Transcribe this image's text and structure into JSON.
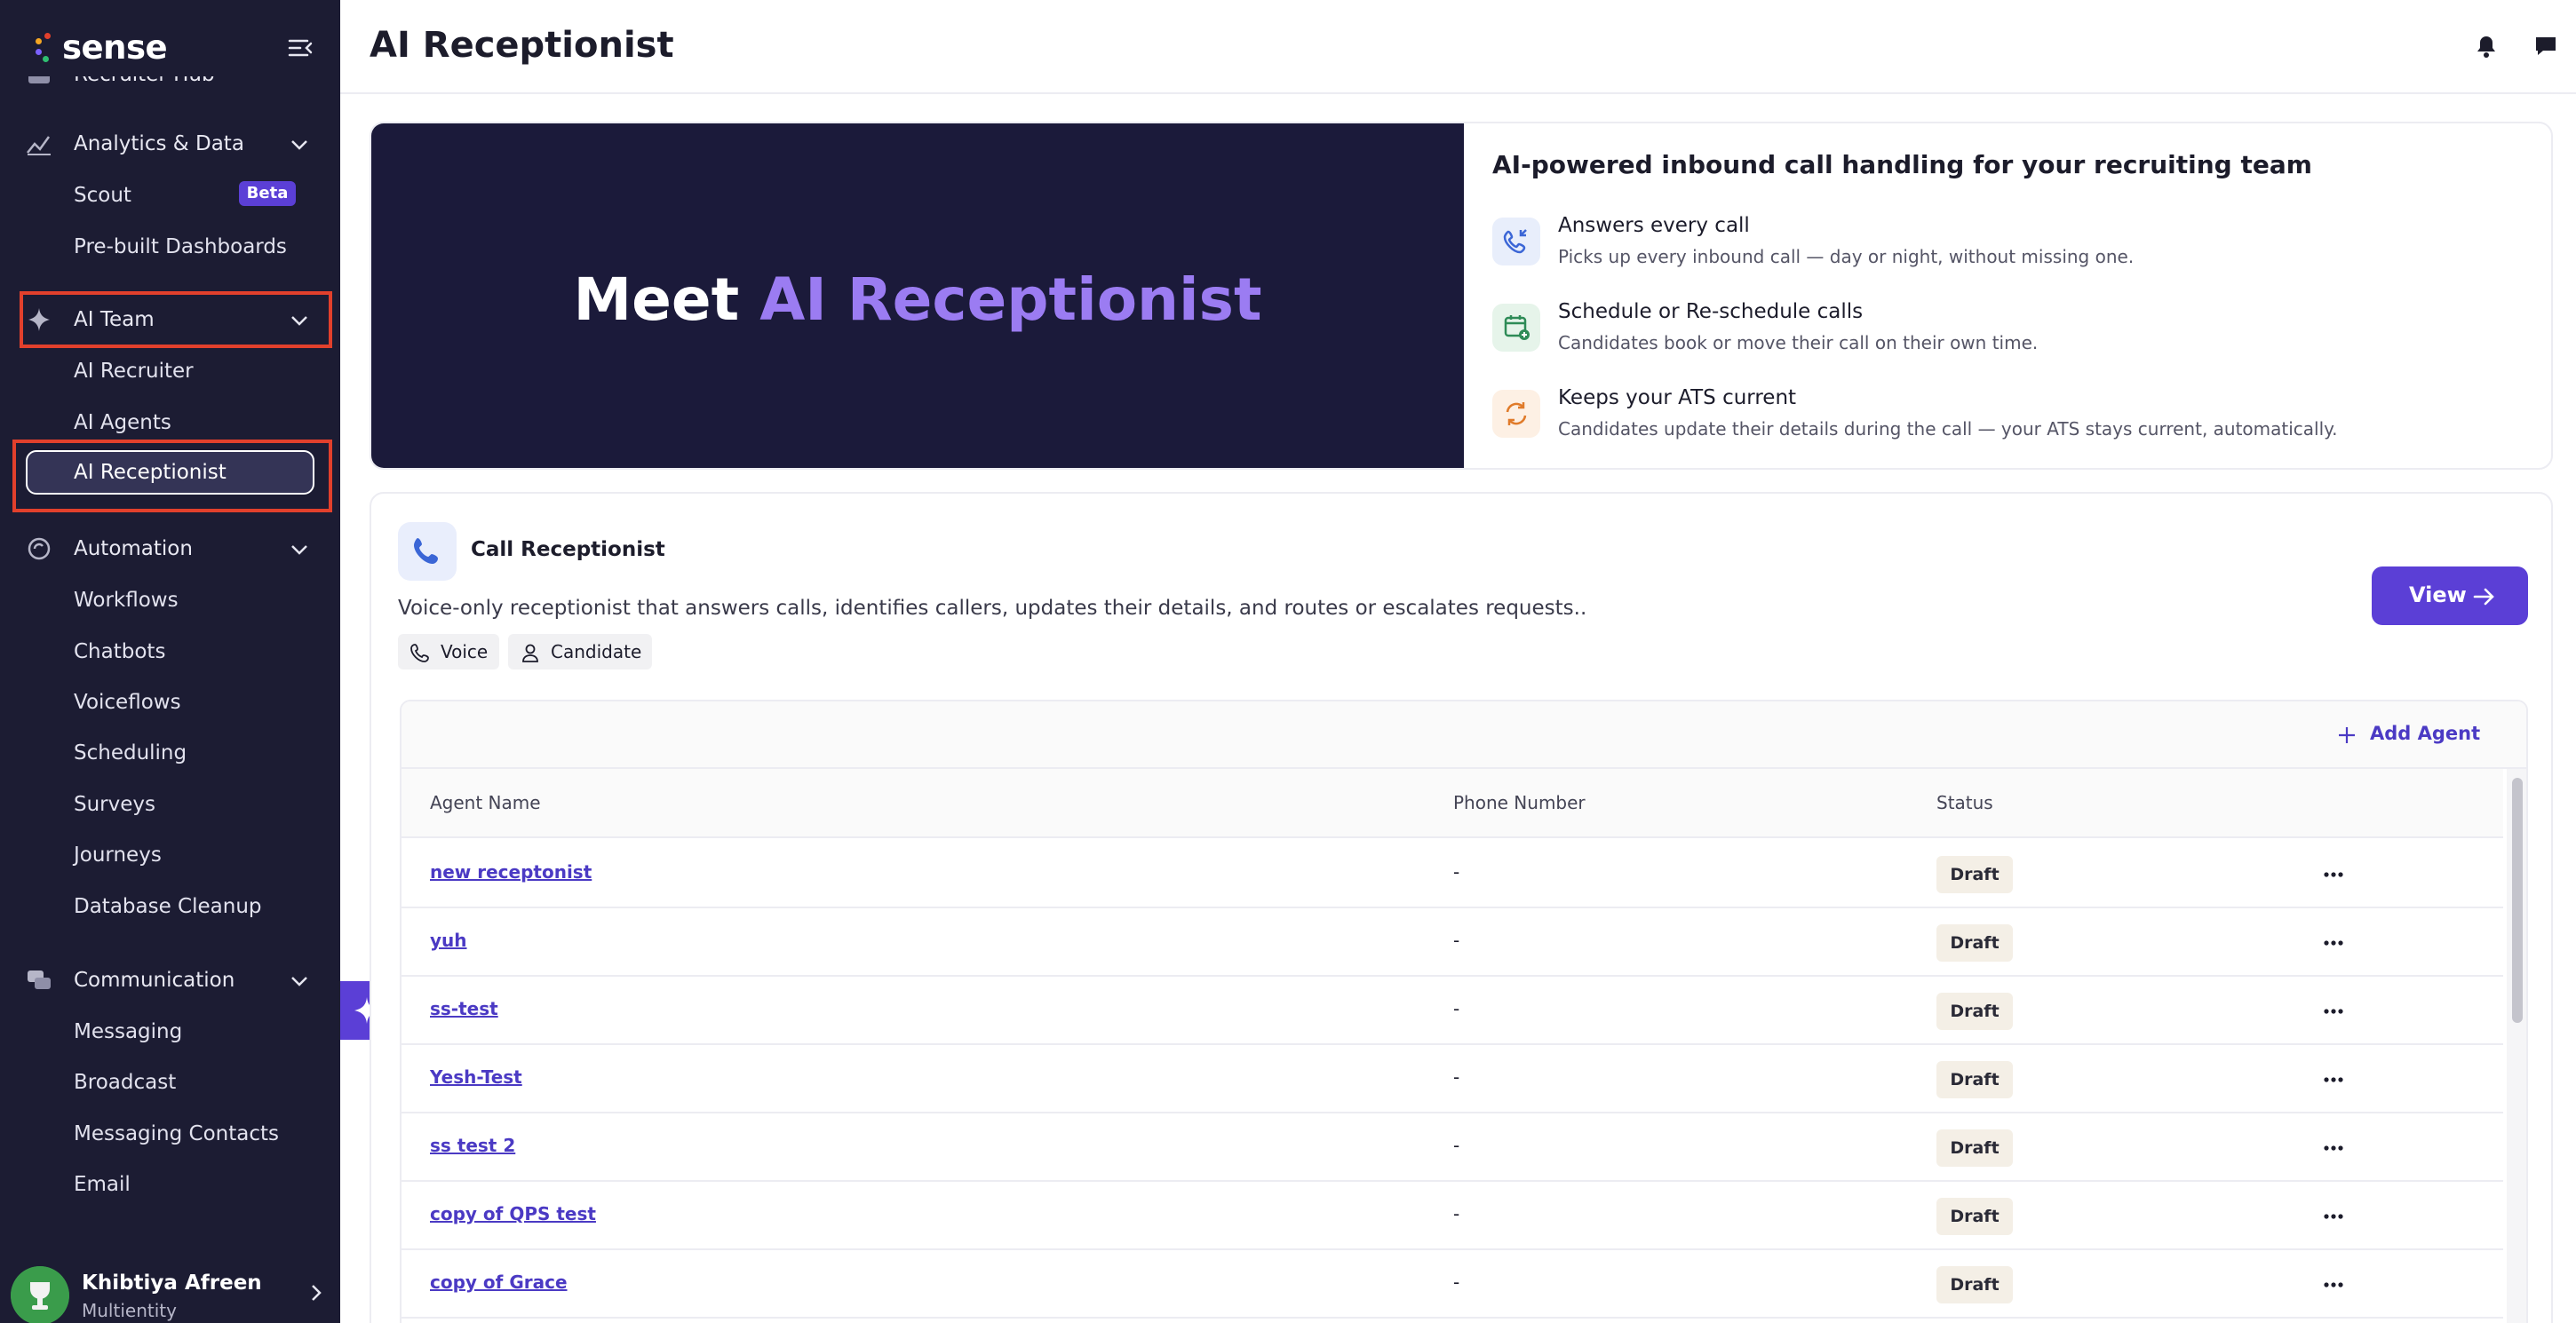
{
  "brand": {
    "name": "sense"
  },
  "sidebar": {
    "partial_top_item": "Recruiter Hub",
    "groups": [
      {
        "label": "Analytics & Data",
        "icon": "analytics-icon",
        "items": [
          "Scout",
          "Pre-built Dashboards"
        ]
      },
      {
        "label": "AI Team",
        "icon": "sparkle-icon",
        "items": [
          "AI Recruiter",
          "AI Agents",
          "AI Receptionist"
        ]
      },
      {
        "label": "Automation",
        "icon": "automation-icon",
        "items": [
          "Workflows",
          "Chatbots",
          "Voiceflows",
          "Scheduling",
          "Surveys",
          "Journeys",
          "Database Cleanup"
        ]
      },
      {
        "label": "Communication",
        "icon": "chat-bubbles-icon",
        "items": [
          "Messaging",
          "Broadcast",
          "Messaging Contacts",
          "Email"
        ]
      }
    ],
    "beta_badge": "Beta",
    "active_item": "AI Receptionist",
    "user": {
      "name": "Khibtiya Afreen",
      "org": "Multientity"
    }
  },
  "header": {
    "title": "AI Receptionist"
  },
  "hero": {
    "title_prefix": "Meet",
    "title_accent": "AI Receptionist",
    "heading": "AI-powered inbound call handling for your recruiting team",
    "features": [
      {
        "title": "Answers every call",
        "desc": "Picks up every inbound call — day or night, without missing one.",
        "icon": "incoming-call-icon",
        "color": "#3b66d6",
        "bg": "#e8eefb"
      },
      {
        "title": "Schedule or Re-schedule calls",
        "desc": "Candidates book or move their call on their own time.",
        "icon": "calendar-add-icon",
        "color": "#2e8b57",
        "bg": "#e6f4ea"
      },
      {
        "title": "Keeps your ATS current",
        "desc": "Candidates update their details during the call — your ATS stays current, automatically.",
        "icon": "sync-icon",
        "color": "#e07b2a",
        "bg": "#fdf0e4"
      }
    ]
  },
  "card": {
    "title": "Call Receptionist",
    "description": "Voice-only receptionist that answers calls, identifies callers, updates their details, and routes or escalates requests..",
    "tags": [
      "Voice",
      "Candidate"
    ],
    "view_label": "View",
    "add_agent_label": "Add Agent"
  },
  "table": {
    "columns": [
      "Agent Name",
      "Phone Number",
      "Status"
    ],
    "rows": [
      {
        "name": "new receptonist",
        "phone": "-",
        "status": "Draft"
      },
      {
        "name": "yuh",
        "phone": "-",
        "status": "Draft"
      },
      {
        "name": "ss-test",
        "phone": "-",
        "status": "Draft"
      },
      {
        "name": "Yesh-Test",
        "phone": "-",
        "status": "Draft"
      },
      {
        "name": "ss test 2",
        "phone": "-",
        "status": "Draft"
      },
      {
        "name": "copy of QPS test",
        "phone": "-",
        "status": "Draft"
      },
      {
        "name": "copy of Grace",
        "phone": "-",
        "status": "Draft"
      }
    ]
  },
  "colors": {
    "sidebar_bg": "#1c1c33",
    "accent": "#5b3fd6",
    "highlight": "#e2402c",
    "hero_bg": "#1b1a3a",
    "hero_accent": "#9b7cf2"
  }
}
